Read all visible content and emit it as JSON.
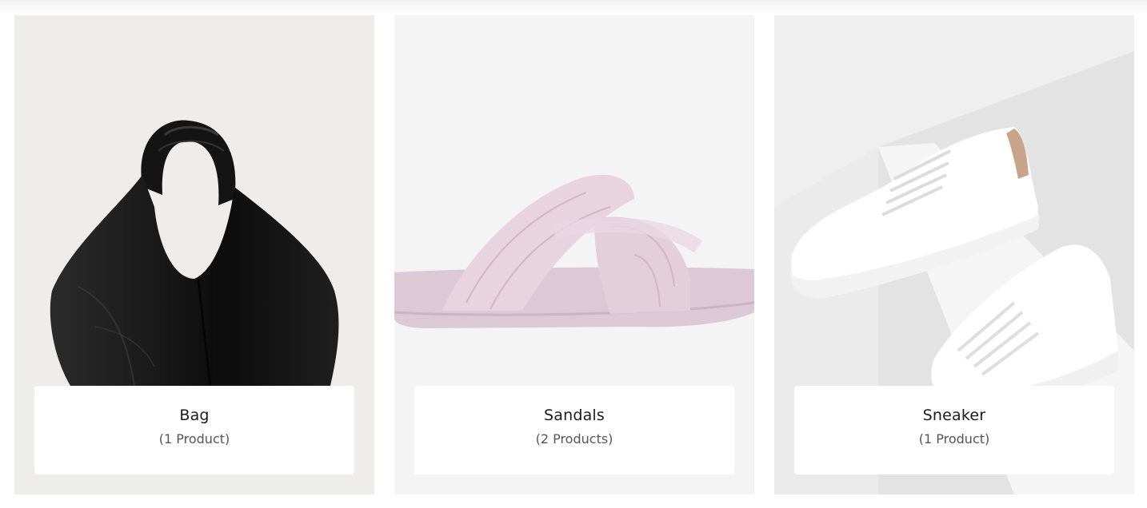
{
  "categories": [
    {
      "name": "Bag",
      "count": "(1 Product)",
      "image_icon": "handbag-icon"
    },
    {
      "name": "Sandals",
      "count": "(2 Products)",
      "image_icon": "sandal-icon"
    },
    {
      "name": "Sneaker",
      "count": "(1 Product)",
      "image_icon": "sneaker-icon"
    }
  ],
  "colors": {
    "bag_bg": "#eeedeb",
    "sandals_bg": "#f4f4f4",
    "sneaker_bg": "#efefef",
    "label_bg": "#ffffff",
    "title_text": "#1a1a1a",
    "count_text": "#555555"
  }
}
